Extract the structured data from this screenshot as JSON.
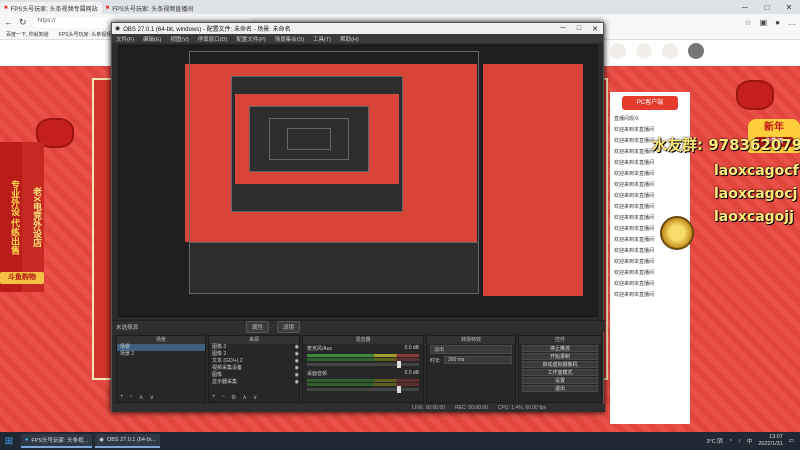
{
  "browser": {
    "tabs": [
      {
        "label": "FPS头号玩家: 头条视频专属网站"
      },
      {
        "label": "FPS头号玩家: 头条视频直播间"
      }
    ],
    "url": "https://",
    "bookmarks": [
      "百度一下, 你就知道",
      "FPS头号玩家: 头条视频直播间"
    ]
  },
  "webpage": {
    "promo_left": "专业外设 代练出售",
    "promo_left2": "老X电竞外设店",
    "promo_tag": "斗鱼购物",
    "pc_badge": "PC客户端",
    "newyear": {
      "title": "新年",
      "sub": "免费领"
    },
    "overlay": {
      "big": "水友群: 978362079",
      "line1": "laoxcagocf",
      "line2": "laoxcagocj",
      "line3": "laoxcagojj"
    },
    "chat_lines": [
      {
        "user": "",
        "text": "直播间观众"
      },
      {
        "user": "",
        "text": "欢迎来到本直播间"
      },
      {
        "user": "",
        "text": "欢迎来到本直播间"
      },
      {
        "user": "",
        "text": "欢迎来到本直播间"
      },
      {
        "user": "",
        "text": "欢迎来到本直播间"
      },
      {
        "user": "",
        "text": "欢迎来到本直播间"
      },
      {
        "user": "",
        "text": "欢迎来到本直播间"
      },
      {
        "user": "",
        "text": "欢迎来到本直播间"
      },
      {
        "user": "",
        "text": "欢迎来到本直播间"
      },
      {
        "user": "",
        "text": "欢迎来到本直播间"
      },
      {
        "user": "",
        "text": "欢迎来到本直播间"
      },
      {
        "user": "",
        "text": "欢迎来到本直播间"
      },
      {
        "user": "",
        "text": "欢迎来到本直播间"
      },
      {
        "user": "",
        "text": "欢迎来到本直播间"
      },
      {
        "user": "",
        "text": "欢迎来到本直播间"
      },
      {
        "user": "",
        "text": "欢迎来到本直播间"
      },
      {
        "user": "",
        "text": "欢迎来到本直播间"
      }
    ]
  },
  "obs": {
    "title": "OBS 27.0.1 (64-bit, windows) - 配置文件: 未命名 - 场景: 未命名",
    "menu": [
      "文件(F)",
      "编辑(E)",
      "视图(V)",
      "停靠窗口(D)",
      "配置文件(P)",
      "场景集合(S)",
      "工具(T)",
      "帮助(H)"
    ],
    "status_mid": {
      "label": "未选择源",
      "props": "属性",
      "filters": "滤镜"
    },
    "scenes": {
      "header": "场景",
      "items": [
        "场景",
        "场景 2"
      ]
    },
    "sources": {
      "header": "来源",
      "items": [
        "图像 3",
        "图像 2",
        "文本 (GDI+) 2",
        "视频采集设备",
        "图像",
        "显示器采集"
      ]
    },
    "mixer": {
      "header": "混音器",
      "channels": [
        {
          "name": "麦克风/Aux",
          "db": "0.0 dB"
        },
        {
          "name": "桌面音频",
          "db": "0.0 dB"
        }
      ]
    },
    "transitions": {
      "header": "转场特效",
      "type": "淡出",
      "duration_label": "时长",
      "duration": "300 ms"
    },
    "controls": {
      "header": "控件",
      "buttons": [
        "停止推流",
        "开始录制",
        "启动虚拟摄像机",
        "工作室模式",
        "设置",
        "退出"
      ]
    },
    "bottom": {
      "live": "LIVE: 00:00:00",
      "rec": "REC: 00:00:00",
      "cpu": "CPU: 1.4%, 60.00 fps"
    }
  },
  "taskbar": {
    "items": [
      "FPS头号玩家: 头条视...",
      "OBS 27.0.1 (64-bi..."
    ],
    "weather": "3°C 阴",
    "ime": "中",
    "time": "13:07",
    "date": "2022/1/31"
  }
}
